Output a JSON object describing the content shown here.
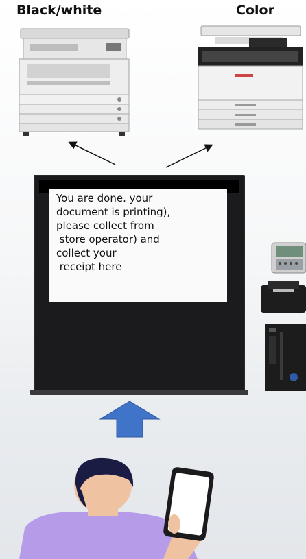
{
  "printers": {
    "black_white_label": "Black/white",
    "color_label": "Color"
  },
  "kiosk": {
    "screen_lines": [
      "You are done. your",
      "document is printing),",
      "please collect from",
      " store operator) and",
      "collect your",
      " receipt here"
    ]
  },
  "icons": {
    "bw_printer": "printer-icon",
    "color_printer": "printer-icon",
    "kiosk": "kiosk-icon",
    "scanner": "card-scanner-icon",
    "receipt_printer": "receipt-printer-icon",
    "computer": "computer-tower-icon",
    "upload_arrow": "arrow-up-icon",
    "user": "person-with-phone-icon"
  },
  "colors": {
    "arrow_blue": "#3f74c9",
    "shirt_purple": "#b59be8",
    "kiosk_black": "#1b1b1d"
  }
}
